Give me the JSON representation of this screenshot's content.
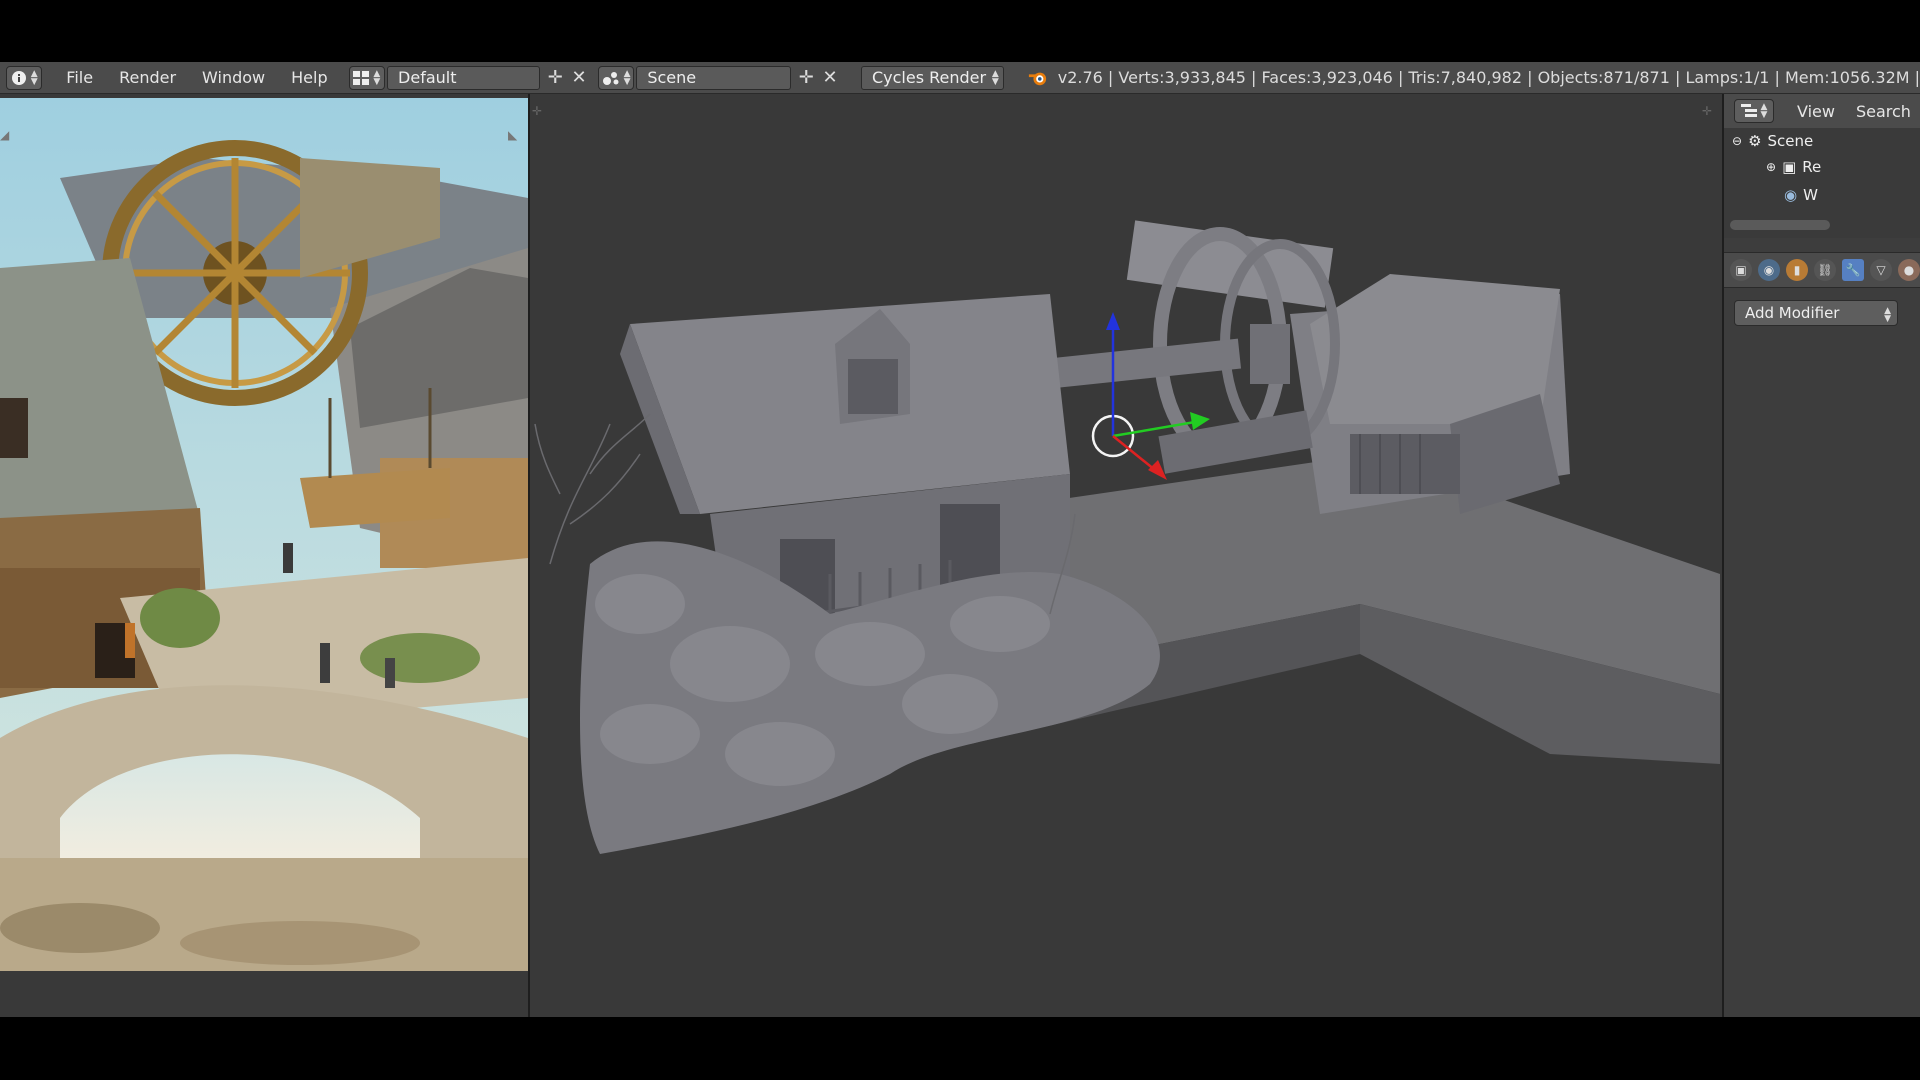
{
  "menubar": {
    "info_icon": "info-icon",
    "items": [
      "File",
      "Render",
      "Window",
      "Help"
    ],
    "layout_value": "Default",
    "scene_value": "Scene",
    "render_engine": "Cycles Render",
    "stats": "v2.76 | Verts:3,933,845 | Faces:3,923,046 | Tris:7,840,982 | Objects:871/871 | Lamps:1/1 | Mem:1056.32M |"
  },
  "outliner": {
    "header_items": [
      "View",
      "Search"
    ],
    "tree": [
      "Scene",
      "Re",
      "W"
    ]
  },
  "properties": {
    "add_modifier_label": "Add Modifier",
    "active_tab": "wrench-icon"
  },
  "colors": {
    "header_bg": "#4b4b4b",
    "viewport_bg": "#393939",
    "active_tab": "#5680c2",
    "axis_x": "#d22",
    "axis_y": "#2c2",
    "axis_z": "#22d"
  }
}
